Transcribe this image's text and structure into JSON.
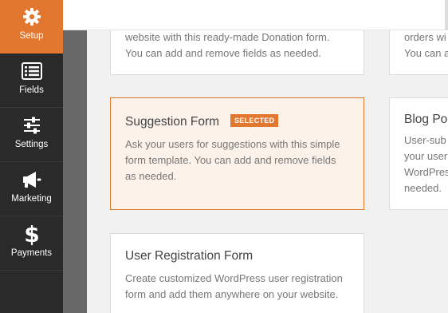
{
  "sidebar": {
    "items": [
      {
        "label": "Setup",
        "icon": "gear-icon",
        "active": true
      },
      {
        "label": "Fields",
        "icon": "list-icon",
        "active": false
      },
      {
        "label": "Settings",
        "icon": "sliders-icon",
        "active": false
      },
      {
        "label": "Marketing",
        "icon": "megaphone-icon",
        "active": false
      },
      {
        "label": "Payments",
        "icon": "dollar-icon",
        "active": false
      }
    ]
  },
  "colors": {
    "accent": "#e27730",
    "sidebar_bg": "#2a2a2a",
    "selected_card_bg": "#fcf2ea"
  },
  "templates": {
    "donation": {
      "desc_line1": "website with this ready-made Donation form.",
      "desc_line2": "You can add and remove fields as needed."
    },
    "right_top": {
      "desc_line1": "orders wi",
      "desc_line2": "You can a"
    },
    "suggestion": {
      "title": "Suggestion Form",
      "badge": "SELECTED",
      "desc_line1": "Ask your users for suggestions with this simple",
      "desc_line2": "form template. You can add and remove fields",
      "desc_line3": "as needed."
    },
    "blog": {
      "title": "Blog Po",
      "desc_line1": "User-sub",
      "desc_line2": "your user",
      "desc_line3": "WordPres",
      "desc_line4": "needed."
    },
    "user_registration": {
      "title": "User Registration Form",
      "desc_line1": "Create customized WordPress user registration",
      "desc_line2": "form and add them anywhere on your website."
    }
  }
}
